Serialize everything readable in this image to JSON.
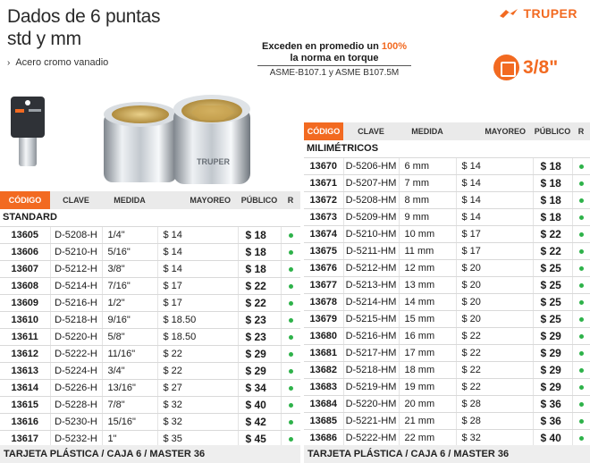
{
  "header": {
    "title_line1": "Dados de 6 puntas",
    "title_line2": "std y mm",
    "bullet": "Acero cromo vanadio",
    "brand": "TRUPER",
    "brand_color": "#f26a21"
  },
  "promo": {
    "line1_pre": "Exceden en promedio un ",
    "line1_pct": "100%",
    "line2": "la norma en torque",
    "line3": "ASME-B107.1 y ASME B107.5M"
  },
  "drive": {
    "label": "3/8\""
  },
  "columns": {
    "code": "CÓDIGO",
    "key": "CLAVE",
    "size": "MEDIDA",
    "wholesale": "MAYOREO",
    "public": "PÚBLICO",
    "r": "R"
  },
  "left_table": {
    "section": "STANDARD",
    "rows": [
      {
        "code": "13605",
        "key": "D-5208-H",
        "size": "1/4\"",
        "wholesale": "$ 14",
        "public": "$ 18"
      },
      {
        "code": "13606",
        "key": "D-5210-H",
        "size": "5/16\"",
        "wholesale": "$ 14",
        "public": "$ 18"
      },
      {
        "code": "13607",
        "key": "D-5212-H",
        "size": "3/8\"",
        "wholesale": "$ 14",
        "public": "$ 18"
      },
      {
        "code": "13608",
        "key": "D-5214-H",
        "size": "7/16\"",
        "wholesale": "$ 17",
        "public": "$ 22"
      },
      {
        "code": "13609",
        "key": "D-5216-H",
        "size": "1/2\"",
        "wholesale": "$ 17",
        "public": "$ 22"
      },
      {
        "code": "13610",
        "key": "D-5218-H",
        "size": "9/16\"",
        "wholesale": "$ 18.50",
        "public": "$ 23"
      },
      {
        "code": "13611",
        "key": "D-5220-H",
        "size": "5/8\"",
        "wholesale": "$ 18.50",
        "public": "$ 23"
      },
      {
        "code": "13612",
        "key": "D-5222-H",
        "size": "11/16\"",
        "wholesale": "$ 22",
        "public": "$ 29"
      },
      {
        "code": "13613",
        "key": "D-5224-H",
        "size": "3/4\"",
        "wholesale": "$ 22",
        "public": "$ 29"
      },
      {
        "code": "13614",
        "key": "D-5226-H",
        "size": "13/16\"",
        "wholesale": "$ 27",
        "public": "$ 34"
      },
      {
        "code": "13615",
        "key": "D-5228-H",
        "size": "7/8\"",
        "wholesale": "$ 32",
        "public": "$ 40"
      },
      {
        "code": "13616",
        "key": "D-5230-H",
        "size": "15/16\"",
        "wholesale": "$ 32",
        "public": "$ 42"
      },
      {
        "code": "13617",
        "key": "D-5232-H",
        "size": "1\"",
        "wholesale": "$ 35",
        "public": "$ 45"
      }
    ],
    "footer": "TARJETA PLÁSTICA / CAJA 6 / MASTER 36"
  },
  "right_table": {
    "section": "MILIMÉTRICOS",
    "rows": [
      {
        "code": "13670",
        "key": "D-5206-HM",
        "size": "6 mm",
        "wholesale": "$ 14",
        "public": "$ 18"
      },
      {
        "code": "13671",
        "key": "D-5207-HM",
        "size": "7 mm",
        "wholesale": "$ 14",
        "public": "$ 18"
      },
      {
        "code": "13672",
        "key": "D-5208-HM",
        "size": "8 mm",
        "wholesale": "$ 14",
        "public": "$ 18"
      },
      {
        "code": "13673",
        "key": "D-5209-HM",
        "size": "9 mm",
        "wholesale": "$ 14",
        "public": "$ 18"
      },
      {
        "code": "13674",
        "key": "D-5210-HM",
        "size": "10 mm",
        "wholesale": "$ 17",
        "public": "$ 22"
      },
      {
        "code": "13675",
        "key": "D-5211-HM",
        "size": "11 mm",
        "wholesale": "$ 17",
        "public": "$ 22"
      },
      {
        "code": "13676",
        "key": "D-5212-HM",
        "size": "12 mm",
        "wholesale": "$ 20",
        "public": "$ 25"
      },
      {
        "code": "13677",
        "key": "D-5213-HM",
        "size": "13 mm",
        "wholesale": "$ 20",
        "public": "$ 25"
      },
      {
        "code": "13678",
        "key": "D-5214-HM",
        "size": "14 mm",
        "wholesale": "$ 20",
        "public": "$ 25"
      },
      {
        "code": "13679",
        "key": "D-5215-HM",
        "size": "15 mm",
        "wholesale": "$ 20",
        "public": "$ 25"
      },
      {
        "code": "13680",
        "key": "D-5216-HM",
        "size": "16 mm",
        "wholesale": "$ 22",
        "public": "$ 29"
      },
      {
        "code": "13681",
        "key": "D-5217-HM",
        "size": "17 mm",
        "wholesale": "$ 22",
        "public": "$ 29"
      },
      {
        "code": "13682",
        "key": "D-5218-HM",
        "size": "18 mm",
        "wholesale": "$ 22",
        "public": "$ 29"
      },
      {
        "code": "13683",
        "key": "D-5219-HM",
        "size": "19 mm",
        "wholesale": "$ 22",
        "public": "$ 29"
      },
      {
        "code": "13684",
        "key": "D-5220-HM",
        "size": "20 mm",
        "wholesale": "$ 28",
        "public": "$ 36"
      },
      {
        "code": "13685",
        "key": "D-5221-HM",
        "size": "21 mm",
        "wholesale": "$ 28",
        "public": "$ 36"
      },
      {
        "code": "13686",
        "key": "D-5222-HM",
        "size": "22 mm",
        "wholesale": "$ 32",
        "public": "$ 40"
      }
    ],
    "footer": "TARJETA PLÁSTICA / CAJA 6 / MASTER 36"
  },
  "availability_color": "#2eb24a",
  "icons": {
    "bullet": "chevron-right-icon",
    "drive": "square-drive-icon",
    "availability": "availability-dot-icon",
    "logo": "truper-logo-icon"
  }
}
